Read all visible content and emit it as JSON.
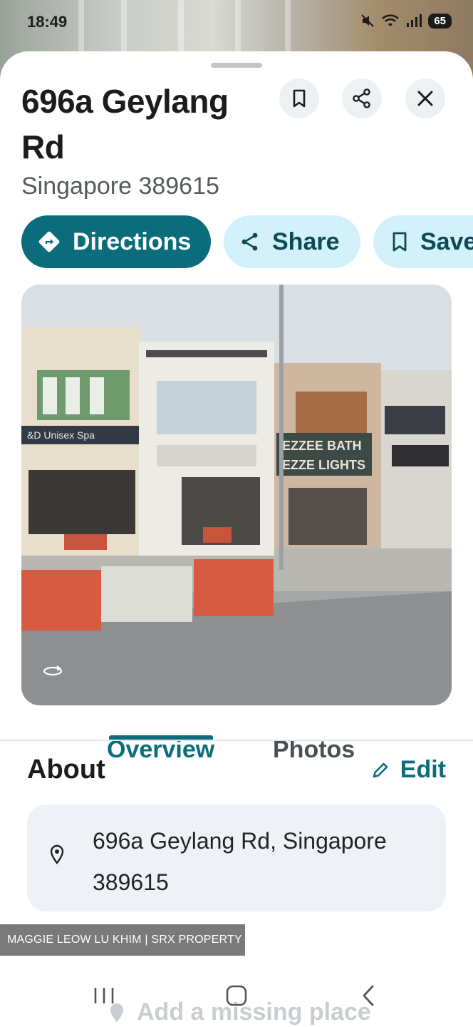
{
  "status_bar": {
    "time": "18:49",
    "battery": "65"
  },
  "place": {
    "title": "696a Geylang Rd",
    "subtitle": "Singapore 389615"
  },
  "header_icons": {
    "bookmark": "bookmark-icon",
    "share": "share-icon",
    "close": "close-icon"
  },
  "actions": {
    "directions_label": "Directions",
    "share_label": "Share",
    "save_label": "Save"
  },
  "tabs": [
    {
      "label": "Overview",
      "active": true
    },
    {
      "label": "Photos",
      "active": false
    }
  ],
  "about": {
    "title": "About",
    "edit_label": "Edit",
    "address": "696a Geylang Rd, Singapore 389615"
  },
  "add_place_label": "Add a missing place",
  "watermark": "MAGGIE LEOW LU KHIM | SRX PROPERTY",
  "photo": {
    "signs": [
      "EZZEE BATH",
      "EZZE LIGHTS",
      "Unisex Spa"
    ]
  },
  "colors": {
    "accent": "#0b6d7c",
    "chip_tonal": "#d2f1fa",
    "card_bg": "#eef2f6"
  }
}
